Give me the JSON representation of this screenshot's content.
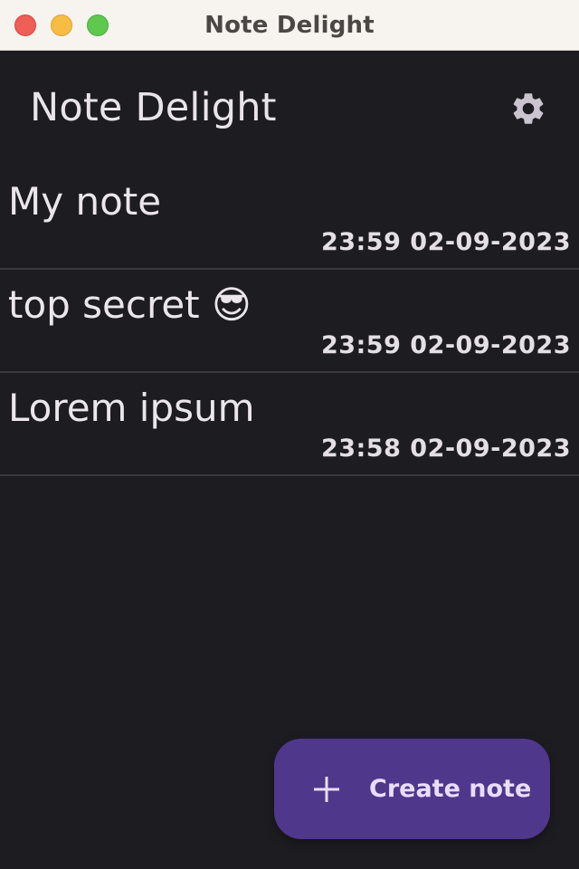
{
  "window": {
    "title": "Note Delight"
  },
  "header": {
    "title": "Note Delight",
    "settings_icon": "gear-icon"
  },
  "notes": [
    {
      "title": "My note",
      "timestamp": "23:59 02-09-2023"
    },
    {
      "title": "top secret 😎",
      "timestamp": "23:59 02-09-2023"
    },
    {
      "title": "Lorem ipsum",
      "timestamp": "23:58 02-09-2023"
    }
  ],
  "fab": {
    "label": "Create note",
    "icon": "plus-icon"
  },
  "colors": {
    "background": "#1d1c21",
    "fab_background": "#4f378b",
    "fab_text": "#e9ddff",
    "text_primary": "#eae6ec",
    "divider": "#3a393e",
    "titlebar": "#f7f3ee"
  }
}
